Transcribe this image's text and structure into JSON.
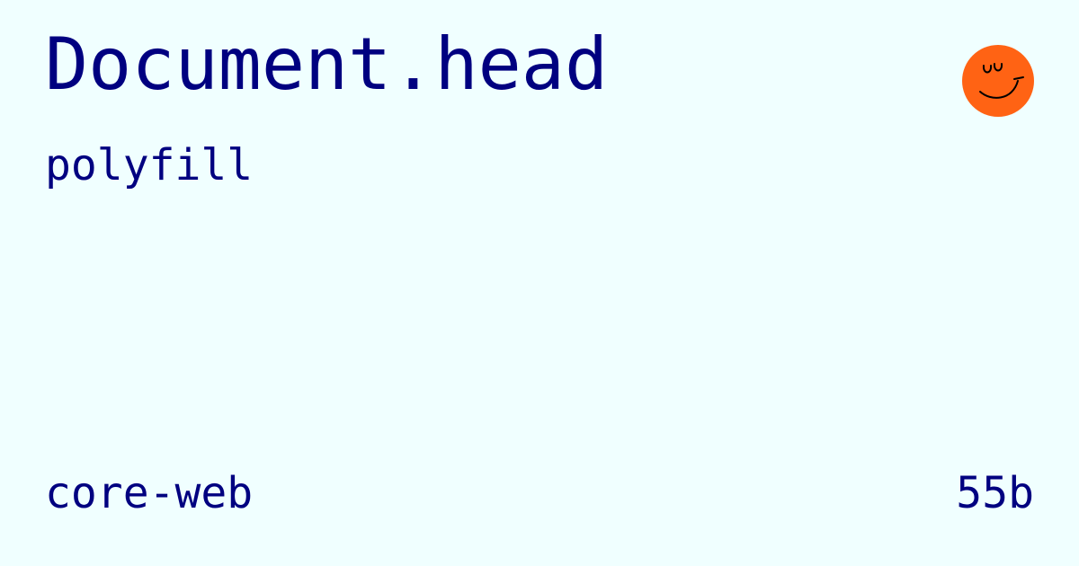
{
  "package": {
    "name": "Document.head",
    "kind": "polyfill",
    "collection": "core-web",
    "size": "55b"
  },
  "logo": {
    "icon": "smiley-face-icon",
    "color": "#ff6314",
    "stroke_color": "#000000"
  },
  "colors": {
    "background": "#f0ffff",
    "text": "#000080"
  }
}
